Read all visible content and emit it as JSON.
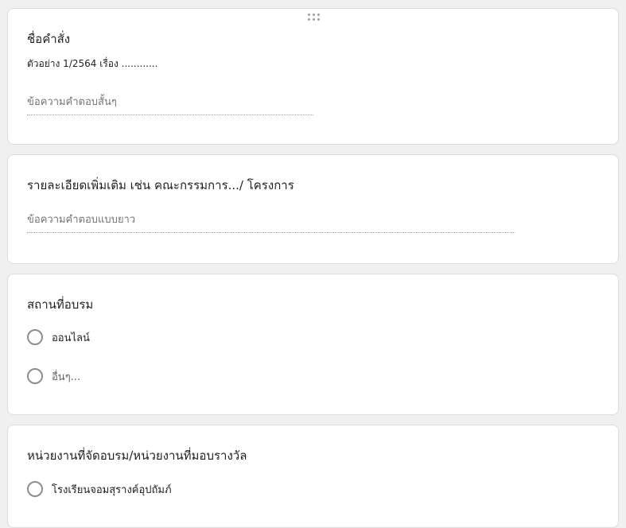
{
  "questions": [
    {
      "title": "ชื่อคำสั่ง",
      "description": "ตัวอย่าง 1/2564  เรื่อง ............",
      "answer_placeholder": "ข้อความคำตอบสั้นๆ"
    },
    {
      "title": "รายละเอียดเพิ่มเติม เช่น คณะกรรมการ.../ โครงการ",
      "answer_placeholder": "ข้อความคำตอบแบบยาว"
    },
    {
      "title": "สถานที่อบรม",
      "options": [
        "ออนไลน์",
        "อื่นๆ..."
      ]
    },
    {
      "title": "หน่วยงานที่จัดอบรม/หน่วยงานที่มอบรางวัล",
      "options": [
        "โรงเรียนจอมสุรางค์อุปถัมภ์"
      ]
    }
  ]
}
